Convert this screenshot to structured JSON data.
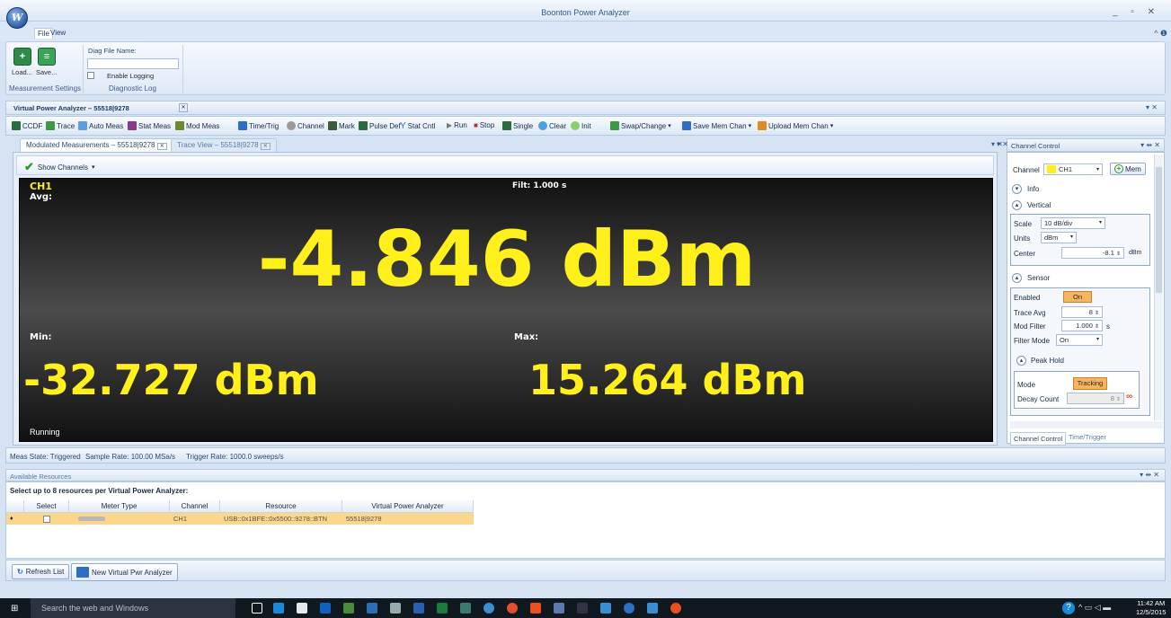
{
  "window": {
    "title": "Boonton Power Analyzer",
    "controls": "_ ▫ ✕",
    "help": "^ ❶"
  },
  "ribbon": {
    "tabs": [
      "File",
      "View"
    ],
    "load_label": "Load...",
    "save_label": "Save...",
    "group_measurement": "Measurement Settings",
    "diag_file_label": "Diag File Name:",
    "diag_file_value": "",
    "enable_logging_label": "Enable Logging",
    "group_diagnostic": "Diagnostic Log"
  },
  "document": {
    "tab_title": "Virtual Power Analyzer – 55518|9278",
    "close": "✕",
    "toolbar": [
      "CCDF",
      "Trace",
      "Auto Meas",
      "Stat Meas",
      "Mod Meas",
      "Time/Trig",
      "Channel",
      "Mark",
      "Pulse Def",
      "Stat Cntl",
      "Run",
      "Stop",
      "Single",
      "Clear",
      "Init",
      "Swap/Change",
      "Save Mem Chan",
      "Upload Mem Chan"
    ],
    "subtabs": [
      "Modulated Measurements – 55518|9278",
      "Trace View – 55518|9278"
    ],
    "show_channels": "Show Channels"
  },
  "display": {
    "channel": "CH1",
    "avg_label": "Avg:",
    "filter": "Filt: 1.000 s",
    "avg_value": "-4.846 dBm",
    "min_label": "Min:",
    "max_label": "Max:",
    "min_value": "-32.727 dBm",
    "max_value": "15.264 dBm",
    "status": "Running",
    "text_color": "#FFEF1A"
  },
  "channel_control": {
    "title": "Channel Control",
    "channel_label": "Channel",
    "channel_value": "CH1",
    "mem_label": "Mem",
    "info_label": "Info",
    "vertical_label": "Vertical",
    "scale_label": "Scale",
    "scale_value": "10 dB/div",
    "units_label": "Units",
    "units_value": "dBm",
    "center_label": "Center",
    "center_value": "-8.1",
    "center_unit": "dBm",
    "sensor_label": "Sensor",
    "enabled_label": "Enabled",
    "enabled_value": "On",
    "trace_avg_label": "Trace Avg",
    "trace_avg_value": "8",
    "mod_filter_label": "Mod Filter",
    "mod_filter_value": "1.000",
    "mod_filter_unit": "s",
    "filter_mode_label": "Filter Mode",
    "filter_mode_value": "On",
    "peak_hold_label": "Peak Hold",
    "mode_label": "Mode",
    "mode_value": "Tracking",
    "decay_label": "Decay Count",
    "decay_value": "8",
    "bottom_tabs": [
      "Channel Control",
      "Time/Trigger"
    ]
  },
  "status_bar": {
    "meas_state": "Meas State: Triggered",
    "sample_rate": "Sample Rate: 100.00 MSa/s",
    "trigger_rate": "Trigger Rate: 1000.0 sweeps/s"
  },
  "resources": {
    "title": "Available Resources",
    "instructions": "Select up to 8 resources per Virtual Power Analyzer:",
    "columns": [
      "Select",
      "Meter Type",
      "Channel",
      "Resource",
      "Virtual Power Analyzer"
    ],
    "rows": [
      {
        "channel": "CH1",
        "resource": "USB::0x1BFE::0x5500::9278::BTN",
        "vpa": "55518|9278"
      }
    ],
    "refresh_label": "Refresh List",
    "new_vpa_label": "New Virtual Pwr Analyzer"
  },
  "taskbar": {
    "search_placeholder": "Search the web and Windows",
    "time": "11:42 AM",
    "date": "12/5/2015"
  }
}
